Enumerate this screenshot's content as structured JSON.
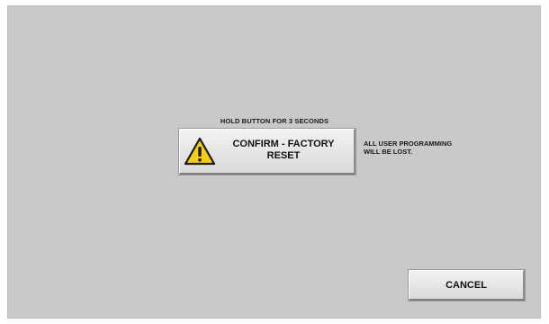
{
  "dialog": {
    "hold_instruction": "HOLD BUTTON FOR 3 SECONDS",
    "confirm_button": {
      "line1": "CONFIRM - FACTORY",
      "line2": "RESET",
      "icon": "warning-triangle-icon"
    },
    "warning_note": {
      "line1": "ALL USER PROGRAMMING",
      "line2": "WILL BE LOST."
    },
    "cancel_button": "CANCEL"
  },
  "colors": {
    "background": "#c9c9c9",
    "button_face": "#e6e6e6",
    "warning_yellow": "#f5d000",
    "text": "#111111"
  }
}
